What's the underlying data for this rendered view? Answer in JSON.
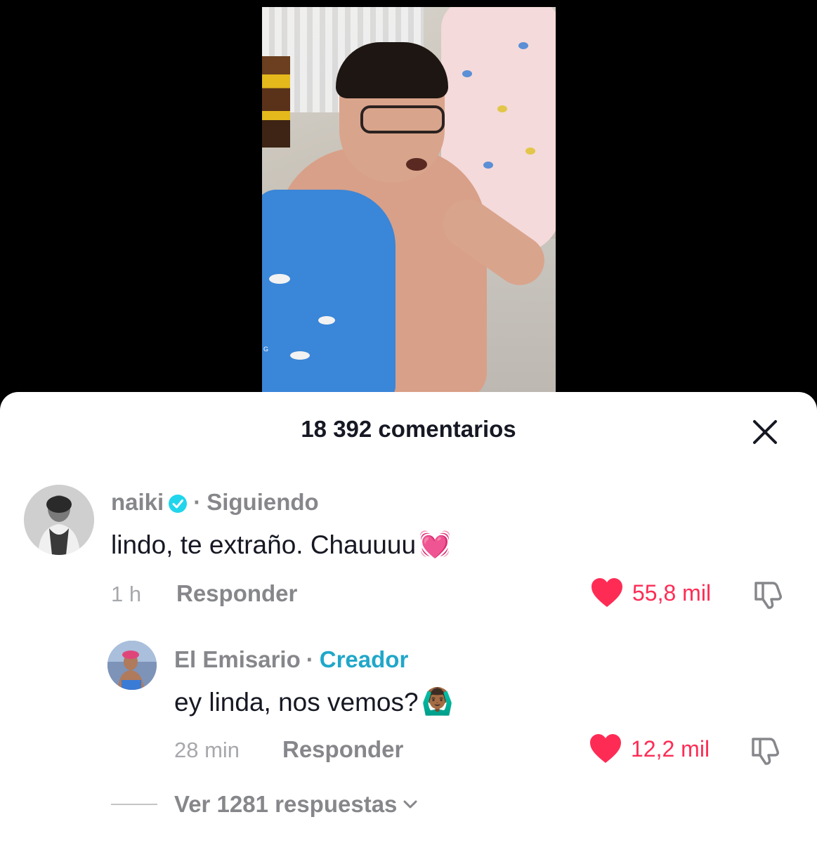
{
  "video": {
    "watermark": "G"
  },
  "sheet": {
    "title": "18 392 comentarios",
    "close_icon": "close-icon"
  },
  "comments": [
    {
      "author": "naiki",
      "verified": true,
      "relation": "Siguiendo",
      "text": "lindo, te extraño. Chauuuu",
      "emoji": "💓",
      "time": "1 h",
      "reply_label": "Responder",
      "likes": "55,8 mil",
      "liked": true
    },
    {
      "author": "El Emisario",
      "verified": false,
      "relation": "Creador",
      "text": "ey linda, nos vemos?",
      "emoji": "🙆🏾‍♂️",
      "time": "28 min",
      "reply_label": "Responder",
      "likes": "12,2 mil",
      "liked": true
    }
  ],
  "view_replies": {
    "label": "Ver 1281 respuestas"
  },
  "colors": {
    "like_red": "#fe2c55",
    "creator_blue": "#20a7c9",
    "muted_gray": "#86878b",
    "text_dark": "#161823"
  }
}
